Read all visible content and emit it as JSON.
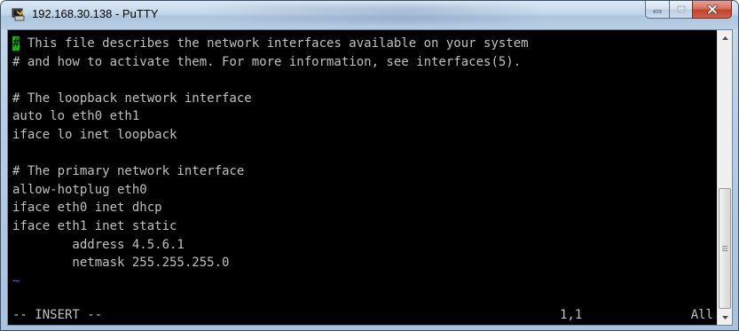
{
  "window": {
    "title": "192.168.30.138 - PuTTY",
    "app_icon": "putty-icon",
    "buttons": [
      "minimize-icon",
      "maximize-icon",
      "close-icon"
    ]
  },
  "terminal": {
    "cursor_char": "#",
    "lines": [
      "# This file describes the network interfaces available on your system",
      "# and how to activate them. For more information, see interfaces(5).",
      "",
      "# The loopback network interface",
      "auto lo eth0 eth1",
      "iface lo inet loopback",
      "",
      "# The primary network interface",
      "allow-hotplug eth0",
      "iface eth0 inet dhcp",
      "iface eth1 inet static",
      "        address 4.5.6.1",
      "        netmask 255.255.255.0",
      "~"
    ],
    "first_line_rest": " This file describes the network interfaces available on your system",
    "status": {
      "mode": "-- INSERT --",
      "position": "1,1",
      "scroll": "All"
    }
  },
  "colors": {
    "terminal_bg": "#000000",
    "terminal_fg": "#c0c0c0",
    "cursor": "#00c000",
    "tilde": "#5555ff",
    "close_button": "#c3432a"
  }
}
